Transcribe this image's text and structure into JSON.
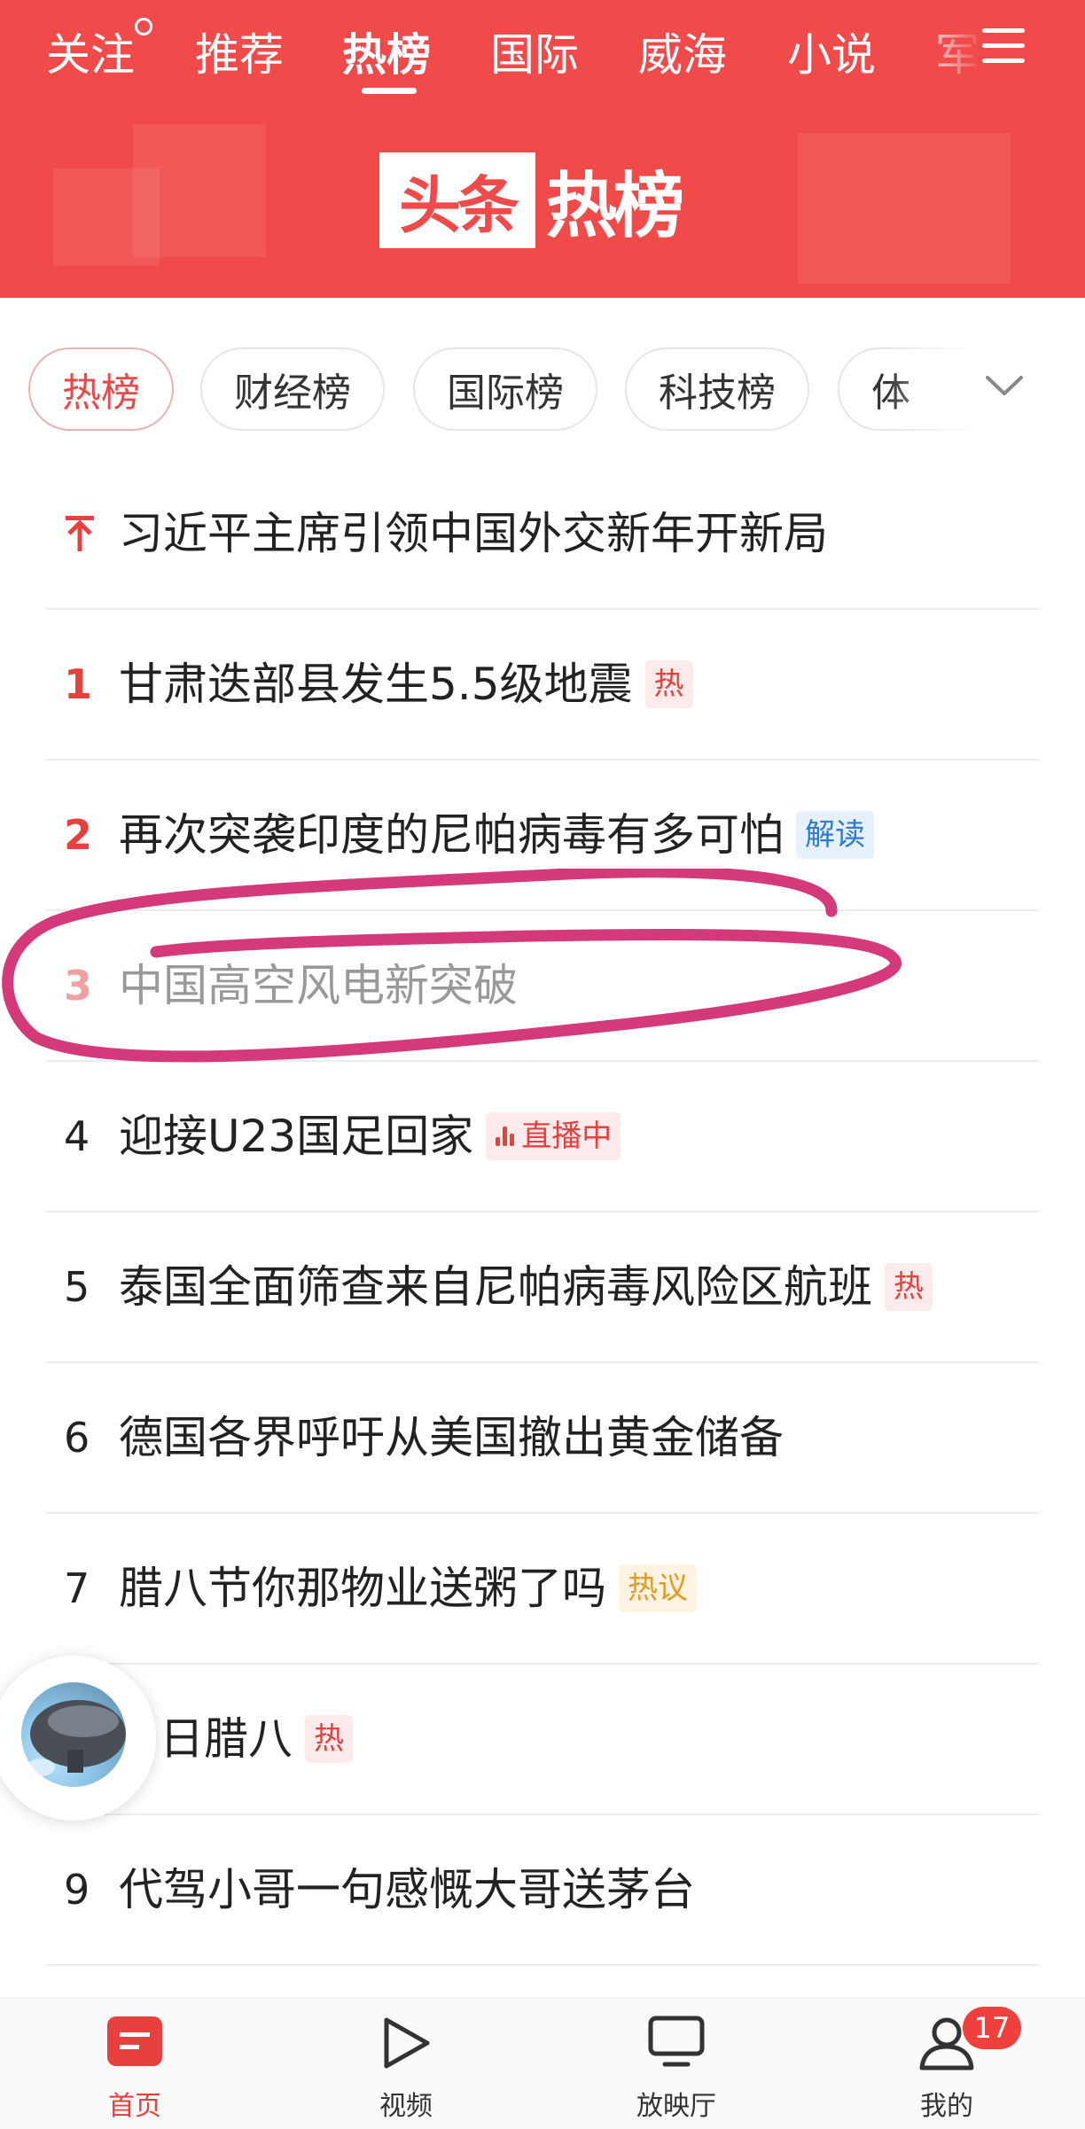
{
  "header": {
    "channels": [
      {
        "label": "关注"
      },
      {
        "label": "推荐"
      },
      {
        "label": "热榜",
        "active": true
      },
      {
        "label": "国际"
      },
      {
        "label": "威海"
      },
      {
        "label": "小说"
      },
      {
        "label": "军"
      }
    ],
    "logo_box": "头条",
    "logo_text": "热榜",
    "brand_color": "#f04a4a"
  },
  "chips": [
    {
      "label": "热榜",
      "active": true
    },
    {
      "label": "财经榜"
    },
    {
      "label": "国际榜"
    },
    {
      "label": "科技榜"
    },
    {
      "label": "体"
    }
  ],
  "hot_list": [
    {
      "rank": "",
      "pinned": true,
      "title": "习近平主席引领中国外交新年开新局",
      "tag": ""
    },
    {
      "rank": "1",
      "title": "甘肃迭部县发生5.5级地震",
      "tag": "热",
      "tag_type": "hot"
    },
    {
      "rank": "2",
      "title": "再次突袭印度的尼帕病毒有多可怕",
      "tag": "解读",
      "tag_type": "read"
    },
    {
      "rank": "3",
      "title": "中国高空风电新突破",
      "tag": "",
      "faded": true
    },
    {
      "rank": "4",
      "title": "迎接U23国足回家",
      "tag": "直播中",
      "tag_type": "live"
    },
    {
      "rank": "5",
      "title": "泰国全面筛查来自尼帕病毒风险区航班",
      "tag": "热",
      "tag_type": "hot"
    },
    {
      "rank": "6",
      "title": "德国各界呼吁从美国撤出黄金储备",
      "tag": ""
    },
    {
      "rank": "7",
      "title": "腊八节你那物业送粥了吗",
      "tag": "热议",
      "tag_type": "discuss"
    },
    {
      "rank": "",
      "title": "日腊八",
      "tag": "热",
      "tag_type": "hot"
    },
    {
      "rank": "9",
      "title": "代驾小哥一句感慨大哥送茅台",
      "tag": ""
    }
  ],
  "bottom_nav": [
    {
      "label": "首页",
      "icon": "home-icon",
      "active": true
    },
    {
      "label": "视频",
      "icon": "play-icon"
    },
    {
      "label": "放映厅",
      "icon": "tv-icon"
    },
    {
      "label": "我的",
      "icon": "user-icon",
      "badge": "17"
    }
  ]
}
